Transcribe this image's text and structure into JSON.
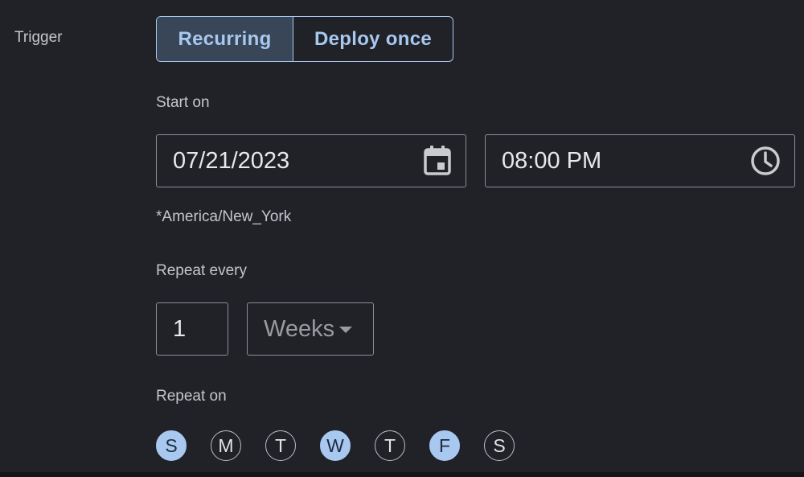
{
  "trigger": {
    "label": "Trigger",
    "options": [
      {
        "label": "Recurring",
        "selected": true
      },
      {
        "label": "Deploy once",
        "selected": false
      }
    ]
  },
  "start": {
    "label": "Start on",
    "date_value": "07/21/2023",
    "date_icon": "calendar-icon",
    "time_value": "08:00 PM",
    "time_icon": "clock-icon",
    "timezone": "*America/New_York"
  },
  "repeat_every": {
    "label": "Repeat every",
    "interval_value": "1",
    "unit_selected": "Weeks"
  },
  "repeat_on": {
    "label": "Repeat on",
    "days": [
      {
        "letter": "S",
        "selected": true
      },
      {
        "letter": "M",
        "selected": false
      },
      {
        "letter": "T",
        "selected": false
      },
      {
        "letter": "W",
        "selected": true
      },
      {
        "letter": "T",
        "selected": false
      },
      {
        "letter": "F",
        "selected": true
      },
      {
        "letter": "S",
        "selected": false
      }
    ]
  },
  "colors": {
    "background": "#202228",
    "accent": "#a8c8f0",
    "selected_segment_bg": "#394658",
    "field_border": "#8c8f96"
  }
}
